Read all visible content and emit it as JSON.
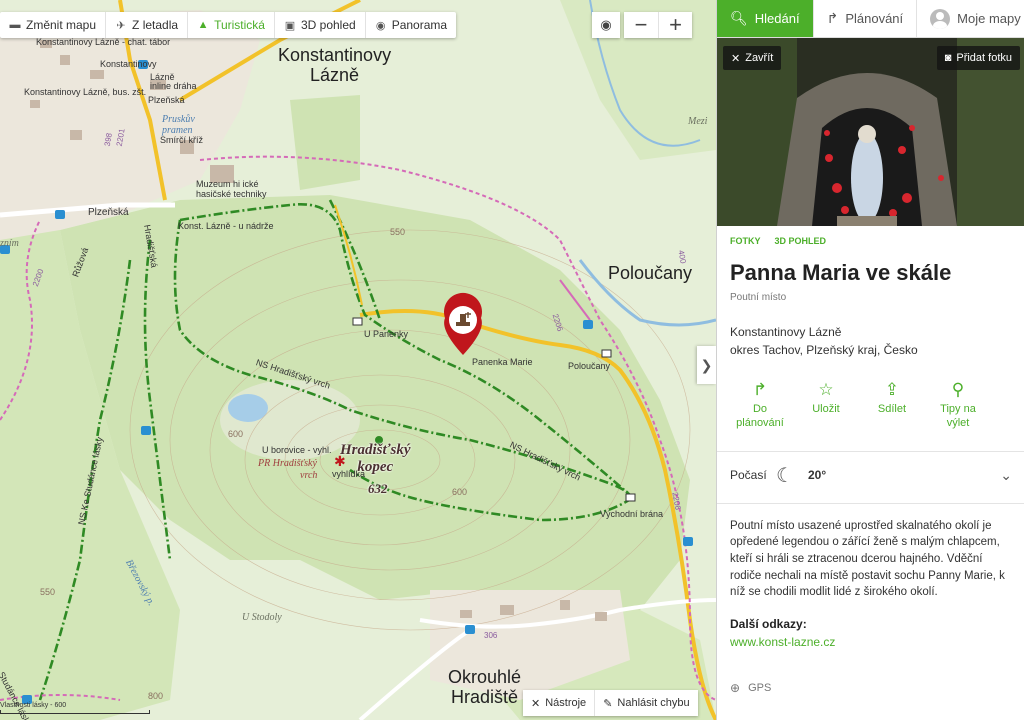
{
  "toolbar": {
    "change_map": "Změnit mapu",
    "aerial": "Z letadla",
    "tourist": "Turistická",
    "view3d": "3D pohled",
    "panorama": "Panorama"
  },
  "zoom": {
    "minus": "−",
    "plus": "+"
  },
  "map_labels": {
    "town1_line1": "Konstantinovy",
    "town1_line2": "Lázně",
    "town2": "Poloučany",
    "town3_line1": "Okrouhlé",
    "town3_line2": "Hradiště",
    "hill_line1": "Hradišťský",
    "hill_line2": "kopec",
    "hill_elev": "632",
    "stop_chat": "Konstantinovy Lázně - chat. tábor",
    "stop_bus": "Konstantinovy Lázně, bus. zšt.",
    "stop_konst": "Konstantinovy",
    "stop_lazne": "Lázně",
    "stop_inline": "inline dráha",
    "plzenska1": "Plzeňská",
    "plzenska2": "Plzeňská",
    "pruskuv1": "Pruskův",
    "pruskuv2": "pramen",
    "smirci": "Smírčí kříž",
    "museum": "Muzeum hi  ické hasičské techniky",
    "nadrazi": "Konst. Lázně - u nádrže",
    "hradistska": "Hradišťská",
    "ruzova": "Růžová",
    "u_panenky": "U Panenky",
    "panenka_marie": "Panenka Marie",
    "poloucany_stop": "Poloučany",
    "ns_vrch1": "NS Hradišťský vrch",
    "ns_vrch2": "NS Hradišťský vrch",
    "ns_studance": "NS Ke Studánce lásky",
    "u_borovice": "U borovice - vyhl.",
    "pr_hradistsky": "PR Hradišťský",
    "vrch": "vrch",
    "vyhlidka": "vyhlídka",
    "vychodni_brana": "Východní brána",
    "u_stodoly": "U Stodoly",
    "mezi": "Mezi",
    "znim": "zním",
    "brezovsky": "Březovský p.",
    "studanka_lasky": "Studánce lásky",
    "elev_550a": "550",
    "elev_550b": "550",
    "elev_600": "600",
    "elev_600b": "600",
    "elev_800": "800",
    "road_2200": "2200",
    "road_2206a": "2206",
    "road_2206b": "2206",
    "road_306": "306",
    "road_398": "398",
    "road_2201": "2201",
    "road_ctxt": "400"
  },
  "scale_text": "Vlastnosti lásky - 600",
  "bottom": {
    "tools": "Nástroje",
    "report": "Nahlásit chybu"
  },
  "panel": {
    "tabs": {
      "search": "Hledání",
      "planning": "Plánování",
      "my_maps": "Moje mapy"
    },
    "photo": {
      "close": "Zavřít",
      "add_photo": "Přidat fotku"
    },
    "subtabs": {
      "photos": "FOTKY",
      "view3d": "3D POHLED"
    },
    "title": "Panna Maria ve skále",
    "category": "Poutní místo",
    "address_line1": "Konstantinovy Lázně",
    "address_line2": "okres Tachov, Plzeňský kraj, Česko",
    "actions": {
      "plan_line1": "Do",
      "plan_line2": "plánování",
      "save": "Uložit",
      "share": "Sdílet",
      "tips_line1": "Tipy na",
      "tips_line2": "výlet"
    },
    "weather": {
      "label": "Počasí",
      "temp": "20°"
    },
    "description": "Poutní místo usazené uprostřed skalnatého okolí je opředené legendou o zářící ženě s malým chlapcem, kteří si hráli se ztracenou dcerou hajného. Vděční rodiče nechali na místě postavit sochu Panny Marie, k níž se chodili modlit lidé z širokého okolí.",
    "links_heading": "Další odkazy:",
    "link": "www.konst-lazne.cz",
    "gps": "GPS"
  },
  "colors": {
    "accent": "#4caf2a",
    "pin": "#c0161c",
    "trail": "#2f8a24",
    "road": "#f2c22a"
  }
}
